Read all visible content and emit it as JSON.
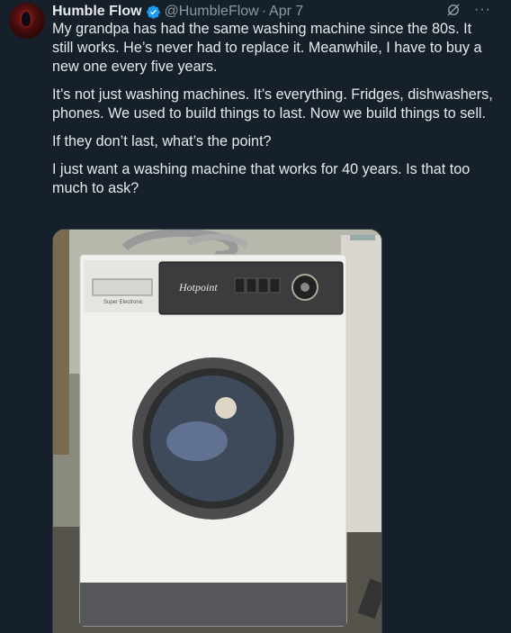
{
  "tweet": {
    "author_name": "Humble Flow",
    "handle": "@HumbleFlow",
    "separator": "·",
    "date": "Apr 7",
    "paragraphs": [
      "My grandpa has had the same washing machine since the 80s. It still works. He’s never had to replace it. Meanwhile, I have to buy a new one every five years.",
      "It’s not just washing machines. It’s everything. Fridges, dishwashers, phones. We used to build things to last. Now we build things to sell.",
      "If they don’t last, what’s the point?",
      "I just want a washing machine that works for 40 years. Is that too much to ask?"
    ],
    "more_label": "···"
  },
  "photo": {
    "brand": "Hotpoint",
    "model_label": "Super Electronic",
    "icons": [
      "verified-badge-icon",
      "grok-icon",
      "more-icon"
    ]
  },
  "colors": {
    "background": "#15202b",
    "text": "#e7e9ea",
    "muted": "#8b98a5",
    "verified": "#1d9bf0"
  }
}
